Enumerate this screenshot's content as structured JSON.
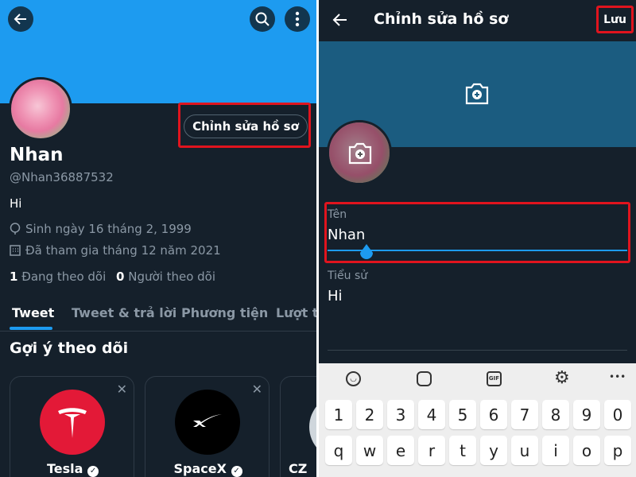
{
  "left": {
    "profile": {
      "name": "Nhan",
      "handle": "@Nhan36887532",
      "bio": "Hi",
      "birth": "Sinh ngày 16 tháng 2, 1999",
      "joined": "Đã tham gia tháng 12 năm 2021",
      "following_count": "1",
      "following_label": "Đang theo dõi",
      "followers_count": "0",
      "followers_label": "Người theo dõi"
    },
    "edit_button": "Chỉnh sửa hồ sơ",
    "tabs": [
      "Tweet",
      "Tweet & trả lời",
      "Phương tiện",
      "Lượt thích"
    ],
    "suggest_title": "Gợi ý theo dõi",
    "suggestions": [
      {
        "name": "Tesla"
      },
      {
        "name": "SpaceX"
      },
      {
        "name": "CZ"
      }
    ],
    "colors": {
      "banner": "#1d9bf0",
      "accent": "#1d9bf0",
      "tesla": "#e31937"
    }
  },
  "right": {
    "title": "Chỉnh sửa hồ sơ",
    "save": "Lưu",
    "name_label": "Tên",
    "name_value": "Nhan",
    "bio_label": "Tiểu sử",
    "bio_value": "Hi",
    "keyboard": {
      "toolbar": [
        "emoji-icon",
        "sticker-icon",
        "gif-icon",
        "settings-icon",
        "more-icon"
      ],
      "gif": "GIF",
      "more": "•••",
      "row1": [
        "1",
        "2",
        "3",
        "4",
        "5",
        "6",
        "7",
        "8",
        "9",
        "0"
      ],
      "row2": [
        "q",
        "w",
        "e",
        "r",
        "t",
        "y",
        "u",
        "i",
        "o",
        "p"
      ]
    }
  }
}
